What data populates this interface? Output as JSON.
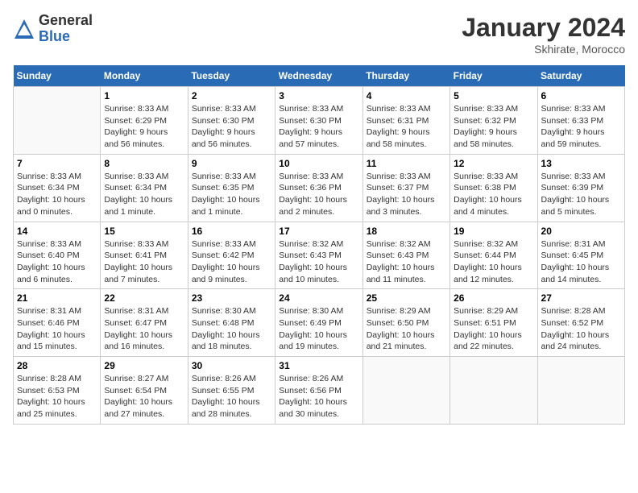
{
  "logo": {
    "general": "General",
    "blue": "Blue"
  },
  "title": "January 2024",
  "subtitle": "Skhirate, Morocco",
  "days_of_week": [
    "Sunday",
    "Monday",
    "Tuesday",
    "Wednesday",
    "Thursday",
    "Friday",
    "Saturday"
  ],
  "weeks": [
    [
      {
        "day": "",
        "info": ""
      },
      {
        "day": "1",
        "info": "Sunrise: 8:33 AM\nSunset: 6:29 PM\nDaylight: 9 hours\nand 56 minutes."
      },
      {
        "day": "2",
        "info": "Sunrise: 8:33 AM\nSunset: 6:30 PM\nDaylight: 9 hours\nand 56 minutes."
      },
      {
        "day": "3",
        "info": "Sunrise: 8:33 AM\nSunset: 6:30 PM\nDaylight: 9 hours\nand 57 minutes."
      },
      {
        "day": "4",
        "info": "Sunrise: 8:33 AM\nSunset: 6:31 PM\nDaylight: 9 hours\nand 58 minutes."
      },
      {
        "day": "5",
        "info": "Sunrise: 8:33 AM\nSunset: 6:32 PM\nDaylight: 9 hours\nand 58 minutes."
      },
      {
        "day": "6",
        "info": "Sunrise: 8:33 AM\nSunset: 6:33 PM\nDaylight: 9 hours\nand 59 minutes."
      }
    ],
    [
      {
        "day": "7",
        "info": "Sunrise: 8:33 AM\nSunset: 6:34 PM\nDaylight: 10 hours\nand 0 minutes."
      },
      {
        "day": "8",
        "info": "Sunrise: 8:33 AM\nSunset: 6:34 PM\nDaylight: 10 hours\nand 1 minute."
      },
      {
        "day": "9",
        "info": "Sunrise: 8:33 AM\nSunset: 6:35 PM\nDaylight: 10 hours\nand 1 minute."
      },
      {
        "day": "10",
        "info": "Sunrise: 8:33 AM\nSunset: 6:36 PM\nDaylight: 10 hours\nand 2 minutes."
      },
      {
        "day": "11",
        "info": "Sunrise: 8:33 AM\nSunset: 6:37 PM\nDaylight: 10 hours\nand 3 minutes."
      },
      {
        "day": "12",
        "info": "Sunrise: 8:33 AM\nSunset: 6:38 PM\nDaylight: 10 hours\nand 4 minutes."
      },
      {
        "day": "13",
        "info": "Sunrise: 8:33 AM\nSunset: 6:39 PM\nDaylight: 10 hours\nand 5 minutes."
      }
    ],
    [
      {
        "day": "14",
        "info": "Sunrise: 8:33 AM\nSunset: 6:40 PM\nDaylight: 10 hours\nand 6 minutes."
      },
      {
        "day": "15",
        "info": "Sunrise: 8:33 AM\nSunset: 6:41 PM\nDaylight: 10 hours\nand 7 minutes."
      },
      {
        "day": "16",
        "info": "Sunrise: 8:33 AM\nSunset: 6:42 PM\nDaylight: 10 hours\nand 9 minutes."
      },
      {
        "day": "17",
        "info": "Sunrise: 8:32 AM\nSunset: 6:43 PM\nDaylight: 10 hours\nand 10 minutes."
      },
      {
        "day": "18",
        "info": "Sunrise: 8:32 AM\nSunset: 6:43 PM\nDaylight: 10 hours\nand 11 minutes."
      },
      {
        "day": "19",
        "info": "Sunrise: 8:32 AM\nSunset: 6:44 PM\nDaylight: 10 hours\nand 12 minutes."
      },
      {
        "day": "20",
        "info": "Sunrise: 8:31 AM\nSunset: 6:45 PM\nDaylight: 10 hours\nand 14 minutes."
      }
    ],
    [
      {
        "day": "21",
        "info": "Sunrise: 8:31 AM\nSunset: 6:46 PM\nDaylight: 10 hours\nand 15 minutes."
      },
      {
        "day": "22",
        "info": "Sunrise: 8:31 AM\nSunset: 6:47 PM\nDaylight: 10 hours\nand 16 minutes."
      },
      {
        "day": "23",
        "info": "Sunrise: 8:30 AM\nSunset: 6:48 PM\nDaylight: 10 hours\nand 18 minutes."
      },
      {
        "day": "24",
        "info": "Sunrise: 8:30 AM\nSunset: 6:49 PM\nDaylight: 10 hours\nand 19 minutes."
      },
      {
        "day": "25",
        "info": "Sunrise: 8:29 AM\nSunset: 6:50 PM\nDaylight: 10 hours\nand 21 minutes."
      },
      {
        "day": "26",
        "info": "Sunrise: 8:29 AM\nSunset: 6:51 PM\nDaylight: 10 hours\nand 22 minutes."
      },
      {
        "day": "27",
        "info": "Sunrise: 8:28 AM\nSunset: 6:52 PM\nDaylight: 10 hours\nand 24 minutes."
      }
    ],
    [
      {
        "day": "28",
        "info": "Sunrise: 8:28 AM\nSunset: 6:53 PM\nDaylight: 10 hours\nand 25 minutes."
      },
      {
        "day": "29",
        "info": "Sunrise: 8:27 AM\nSunset: 6:54 PM\nDaylight: 10 hours\nand 27 minutes."
      },
      {
        "day": "30",
        "info": "Sunrise: 8:26 AM\nSunset: 6:55 PM\nDaylight: 10 hours\nand 28 minutes."
      },
      {
        "day": "31",
        "info": "Sunrise: 8:26 AM\nSunset: 6:56 PM\nDaylight: 10 hours\nand 30 minutes."
      },
      {
        "day": "",
        "info": ""
      },
      {
        "day": "",
        "info": ""
      },
      {
        "day": "",
        "info": ""
      }
    ]
  ]
}
